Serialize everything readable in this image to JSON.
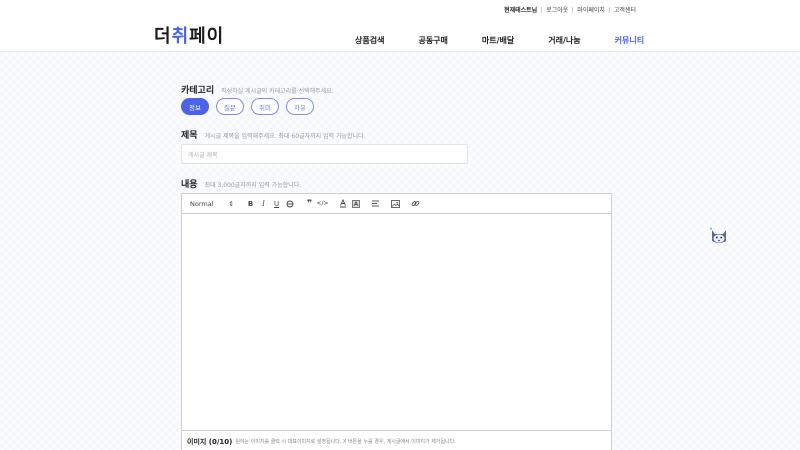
{
  "header": {
    "top_links": [
      "현재테스트님",
      "로그아웃",
      "마이페이지",
      "고객센터"
    ],
    "logo": {
      "part1": "더",
      "accent": "취",
      "part2": "페이"
    },
    "nav": [
      "상품검색",
      "공동구매",
      "마트/배달",
      "거래/나눔",
      "커뮤니티"
    ],
    "active_nav": "커뮤니티",
    "accent_color": "#4a63e8"
  },
  "form": {
    "category": {
      "label": "카테고리",
      "hint": "작성하실 게시글의 카테고리를 선택해주세요.",
      "options": [
        "정보",
        "질문",
        "취미",
        "자유"
      ],
      "selected": "정보"
    },
    "title": {
      "label": "제목",
      "hint": "게시글 제목을 입력해주세요. 최대 60글자까지 입력 가능합니다.",
      "placeholder": "게시글 제목",
      "value": ""
    },
    "content": {
      "label": "내용",
      "hint": "최대 3,000글자까지 입력 가능합니다.",
      "toolbar": {
        "format": "Normal",
        "buttons": [
          "bold-icon",
          "italic-icon",
          "underline-icon",
          "strike-icon",
          "blockquote-icon",
          "code-icon",
          "text-color-icon",
          "background-color-icon",
          "align-icon",
          "image-icon",
          "link-icon"
        ]
      }
    },
    "images": {
      "title": "이미지 (0/10)",
      "description": "원하는 이미지를 클릭 시 대표이미지로 설정됩니다. X 버튼을 누를 경우, 게시글에서 이미지가 제거됩니다."
    }
  },
  "floating": {
    "icon": "mascot-icon"
  }
}
